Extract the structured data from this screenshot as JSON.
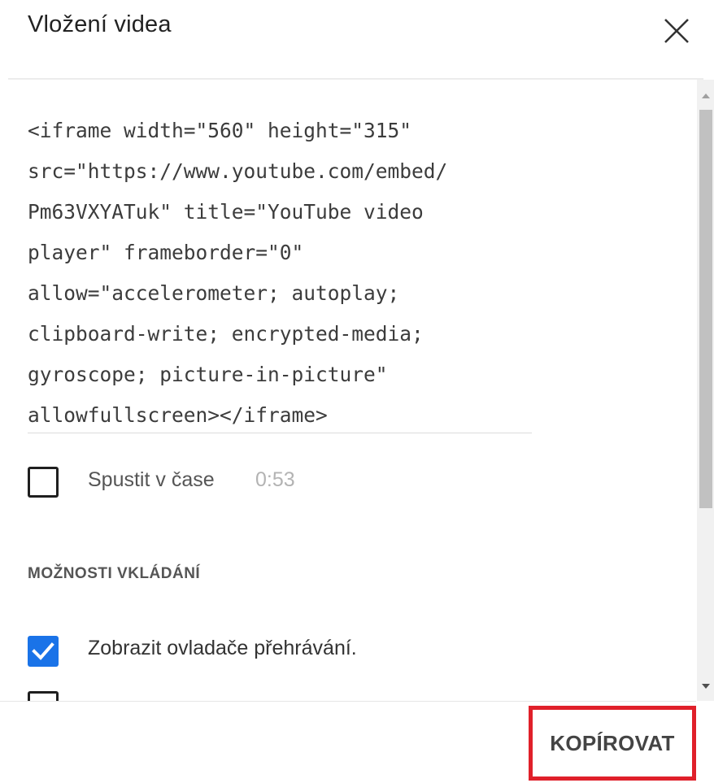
{
  "dialog": {
    "title": "Vložení videa",
    "close_icon": "close-icon"
  },
  "embed_code": {
    "lines": [
      "<iframe width=\"560\" height=\"315\"",
      "src=\"https://www.youtube.com/embed/",
      "Pm63VXYATuk\" title=\"YouTube video",
      "player\" frameborder=\"0\"",
      "allow=\"accelerometer; autoplay;",
      "clipboard-write; encrypted-media;",
      "gyroscope; picture-in-picture\"",
      "allowfullscreen></iframe>"
    ]
  },
  "start_at": {
    "label": "Spustit v čase",
    "time": "0:53",
    "checked": false
  },
  "options": {
    "heading": "MOŽNOSTI VKLÁDÁNÍ",
    "show_controls": {
      "label": "Zobrazit ovladače přehrávání.",
      "checked": true
    }
  },
  "footer": {
    "copy_label": "KOPÍROVAT",
    "highlight_color": "#e0202a"
  },
  "colors": {
    "accent": "#1a73e8"
  }
}
